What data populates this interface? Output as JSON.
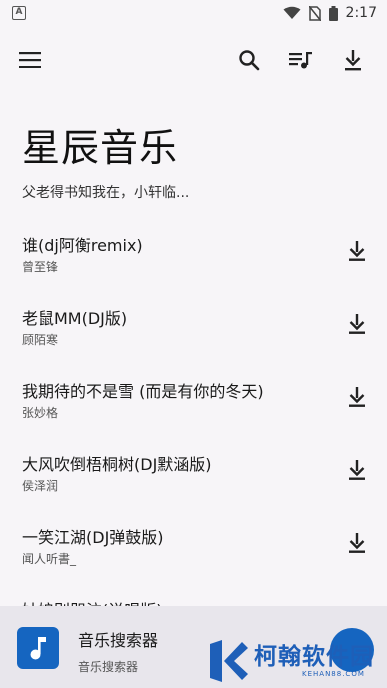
{
  "status_bar": {
    "notification_letter": "A",
    "time": "2:17",
    "icons": [
      "wifi-icon",
      "no-sim-icon",
      "battery-icon"
    ]
  },
  "app_bar": {
    "icons": [
      "menu-icon",
      "search-icon",
      "queue-music-icon",
      "download-icon"
    ]
  },
  "header": {
    "title": "星辰音乐",
    "subtitle": "父老得书知我在，小轩临..."
  },
  "songs": [
    {
      "title": "谁(dj阿衡remix)",
      "artist": "曾至锋"
    },
    {
      "title": "老鼠MM(DJ版)",
      "artist": "顾陌寒"
    },
    {
      "title": "我期待的不是雪 (而是有你的冬天)",
      "artist": "张妙格"
    },
    {
      "title": "大风吹倒梧桐树(DJ默涵版)",
      "artist": "侯泽润"
    },
    {
      "title": "一笑江湖(DJ弹鼓版)",
      "artist": "闻人听書_"
    },
    {
      "title": "姑娘别哭泣(说唱版)",
      "artist": ""
    }
  ],
  "player": {
    "title": "音乐搜索器",
    "subtitle": "音乐搜索器",
    "art_icon": "music-note-icon"
  },
  "watermark": {
    "name": "柯翰软件园",
    "url": "KEHAN88.COM"
  },
  "colors": {
    "background": "#f7f5f8",
    "accent": "#1565c0",
    "player_bg": "#e8e6ec"
  }
}
